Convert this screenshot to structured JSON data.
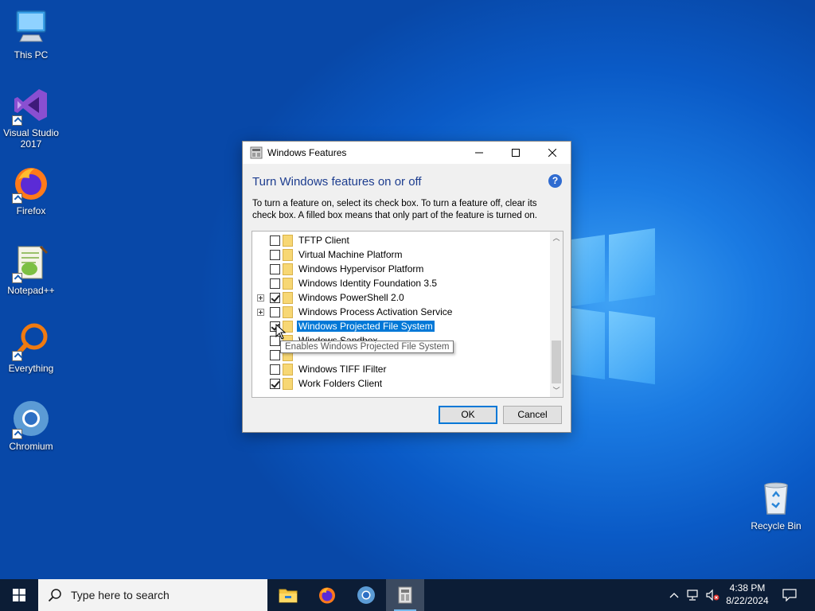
{
  "desktop": {
    "icons": [
      {
        "label": "This PC",
        "icon": "computer-icon"
      },
      {
        "label": "Visual Studio 2017",
        "icon": "visual-studio-icon"
      },
      {
        "label": "Firefox",
        "icon": "firefox-icon"
      },
      {
        "label": "Notepad++",
        "icon": "notepadpp-icon"
      },
      {
        "label": "Everything",
        "icon": "everything-search-icon"
      },
      {
        "label": "Chromium",
        "icon": "chromium-icon"
      },
      {
        "label": "Recycle Bin",
        "icon": "recycle-bin-icon"
      }
    ]
  },
  "dialog": {
    "title": "Windows Features",
    "heading": "Turn Windows features on or off",
    "description": "To turn a feature on, select its check box. To turn a feature off, clear its check box. A filled box means that only part of the feature is turned on.",
    "help_label": "?",
    "features": [
      {
        "label": "TFTP Client",
        "checked": false,
        "expandable": false
      },
      {
        "label": "Virtual Machine Platform",
        "checked": false,
        "expandable": false
      },
      {
        "label": "Windows Hypervisor Platform",
        "checked": false,
        "expandable": false
      },
      {
        "label": "Windows Identity Foundation 3.5",
        "checked": false,
        "expandable": false
      },
      {
        "label": "Windows PowerShell 2.0",
        "checked": true,
        "expandable": true
      },
      {
        "label": "Windows Process Activation Service",
        "checked": false,
        "expandable": true
      },
      {
        "label": "Windows Projected File System",
        "checked": true,
        "expandable": false,
        "selected": true
      },
      {
        "label": "Windows Sandbox",
        "checked": false,
        "expandable": false
      },
      {
        "label": "",
        "checked": false,
        "expandable": false
      },
      {
        "label": "Windows TIFF IFilter",
        "checked": false,
        "expandable": false
      },
      {
        "label": "Work Folders Client",
        "checked": true,
        "expandable": false
      }
    ],
    "tooltip": "Enables Windows Projected File System",
    "ok_label": "OK",
    "cancel_label": "Cancel"
  },
  "taskbar": {
    "search_placeholder": "Type here to search",
    "apps": [
      "file-explorer-icon",
      "firefox-icon",
      "chromium-icon",
      "windows-features-icon"
    ],
    "time": "4:38 PM",
    "date": "8/22/2024"
  },
  "colors": {
    "accent": "#0078d7",
    "heading": "#1d3d8f",
    "taskbar": "#0c1d36"
  }
}
